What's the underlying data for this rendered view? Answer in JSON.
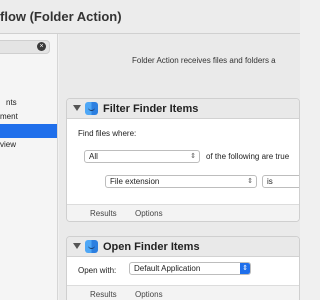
{
  "window": {
    "title": "flow (Folder Action)"
  },
  "sidebar": {
    "items": [
      {
        "label": "nts"
      },
      {
        "label": "ment"
      },
      {
        "label": ""
      },
      {
        "label": "view"
      }
    ],
    "selected_index": 2
  },
  "main": {
    "description": "Folder Action receives files and folders a"
  },
  "filter_action": {
    "title": "Filter Finder Items",
    "find_label": "Find files where:",
    "match_select": "All",
    "following_text": "of the following are true",
    "criteria_field": "File extension",
    "criteria_operator": "is",
    "tabs": [
      "Results",
      "Options"
    ]
  },
  "open_action": {
    "title": "Open Finder Items",
    "open_with_label": "Open with:",
    "open_with_value": "Default Application",
    "tabs": [
      "Results",
      "Options"
    ]
  }
}
